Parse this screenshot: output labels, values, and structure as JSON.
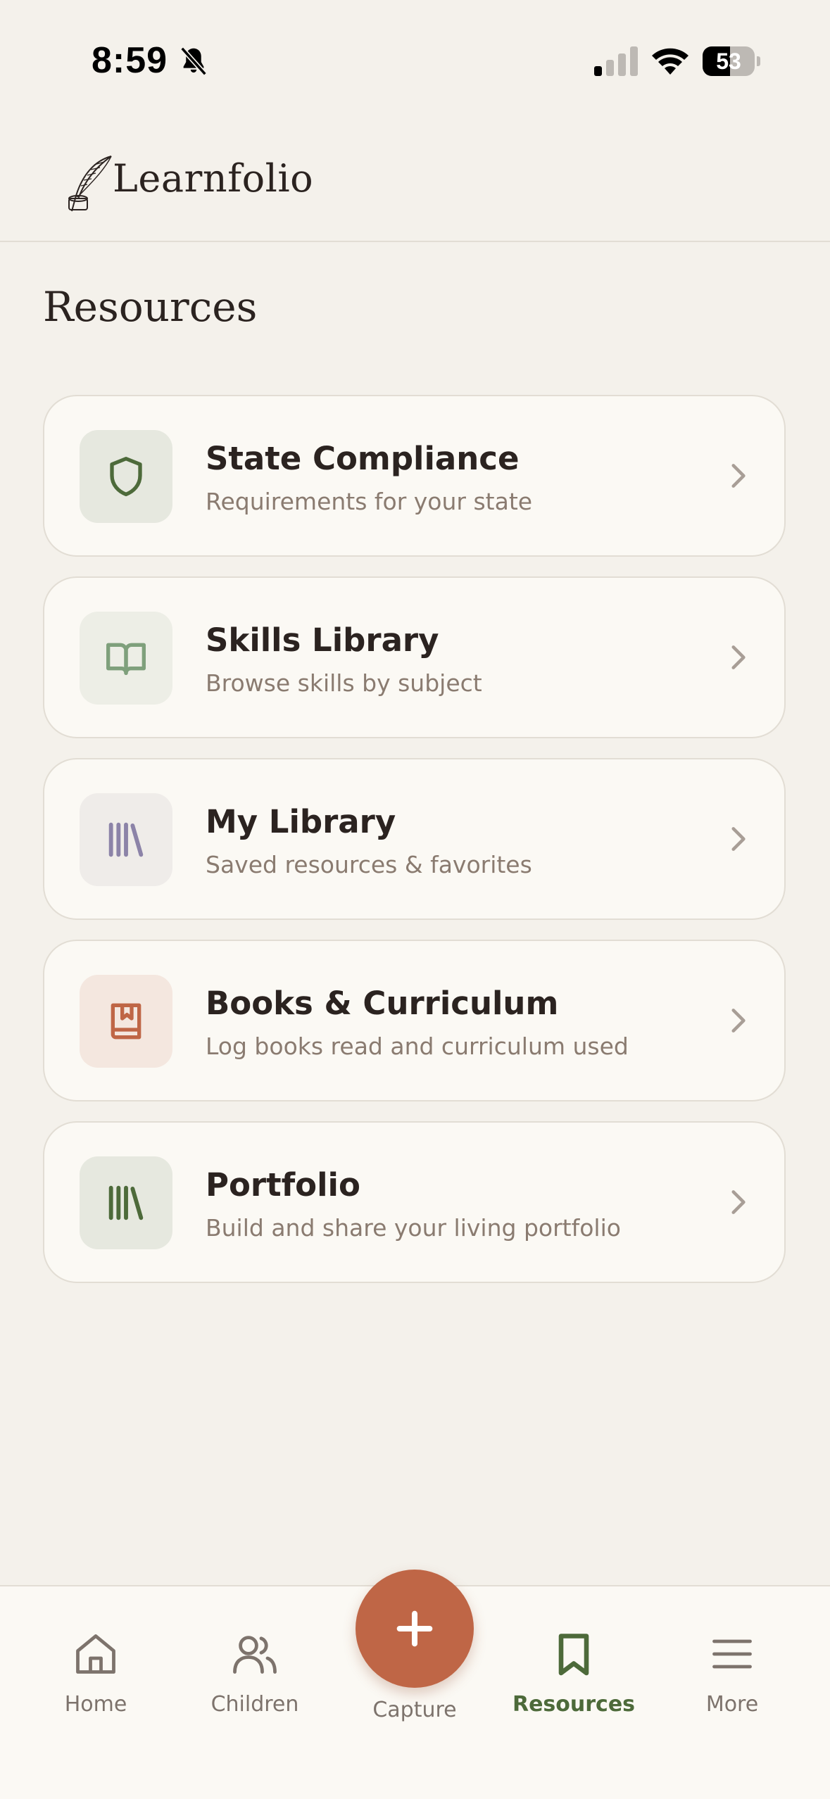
{
  "status": {
    "time": "8:59",
    "battery": "53",
    "battery_level": 0.53,
    "icons": [
      "bell-slash-icon",
      "signal-icon",
      "wifi-icon",
      "battery-icon"
    ]
  },
  "header": {
    "logo_text": "Learnfolio",
    "logo_icon": "quill-icon"
  },
  "page": {
    "title": "Resources"
  },
  "cards": [
    {
      "title": "State Compliance",
      "subtitle": "Requirements for your state",
      "icon": "shield-icon",
      "icon_color": "#4d6a3a",
      "icon_bg": "#e6e8df"
    },
    {
      "title": "Skills Library",
      "subtitle": "Browse skills by subject",
      "icon": "book-open-icon",
      "icon_color": "#7fa07c",
      "icon_bg": "#edeee6"
    },
    {
      "title": "My Library",
      "subtitle": "Saved resources & favorites",
      "icon": "library-icon",
      "icon_color": "#8c83a8",
      "icon_bg": "#efece9"
    },
    {
      "title": "Books & Curriculum",
      "subtitle": "Log books read and curriculum used",
      "icon": "book-bookmark-icon",
      "icon_color": "#bf6646",
      "icon_bg": "#f4e7df"
    },
    {
      "title": "Portfolio",
      "subtitle": "Build and share your living portfolio",
      "icon": "library-icon",
      "icon_color": "#4d6a3a",
      "icon_bg": "#e6e8df"
    }
  ],
  "tabbar": {
    "home": "Home",
    "children": "Children",
    "capture": "Capture",
    "resources": "Resources",
    "more": "More",
    "active": "resources"
  },
  "colors": {
    "background": "#f4f1eb",
    "card": "#fbf9f4",
    "accent": "#bf6646",
    "active_tab": "#4d6a3a",
    "muted_text": "#8a7b70"
  }
}
